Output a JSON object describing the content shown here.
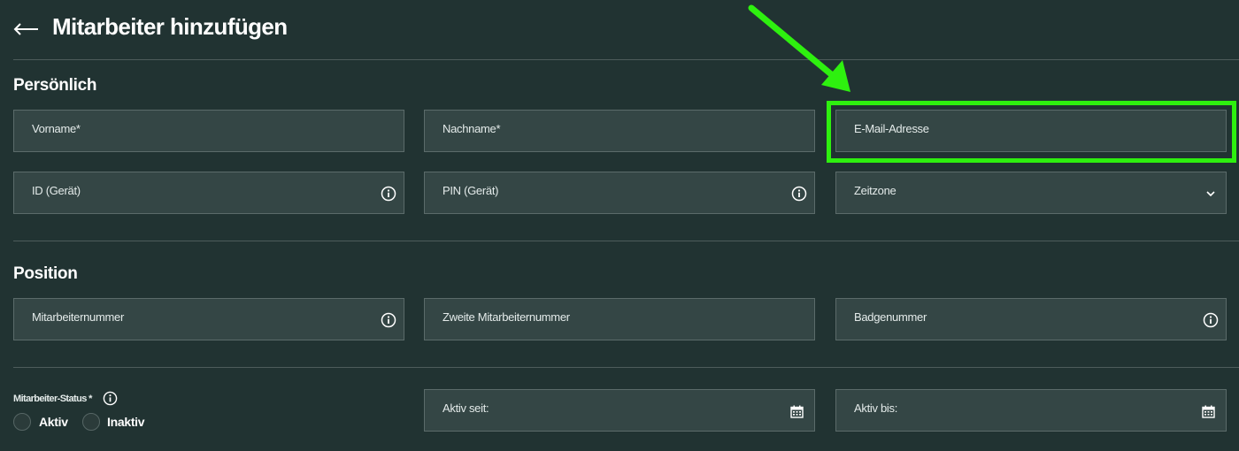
{
  "header": {
    "back_icon": "arrow-left-icon",
    "title": "Mitarbeiter hinzufügen"
  },
  "sections": {
    "personal": {
      "title": "Persönlich",
      "fields": {
        "first_name": "Vorname*",
        "last_name": "Nachname*",
        "email": "E-Mail-Adresse",
        "device_id": "ID (Gerät)",
        "device_pin": "PIN (Gerät)",
        "timezone": "Zeitzone"
      }
    },
    "position": {
      "title": "Position",
      "fields": {
        "employee_number": "Mitarbeiternummer",
        "second_employee_number": "Zweite Mitarbeiternummer",
        "badge_number": "Badgenummer"
      }
    },
    "status": {
      "label": "Mitarbeiter-Status *",
      "options": [
        "Aktiv",
        "Inaktiv"
      ],
      "active_since": "Aktiv seit:",
      "active_until": "Aktiv bis:"
    }
  },
  "annotation": {
    "color": "#2ef00f"
  },
  "colors": {
    "background": "#213332",
    "field_background": "#344645",
    "field_border": "#5b6b6a"
  }
}
